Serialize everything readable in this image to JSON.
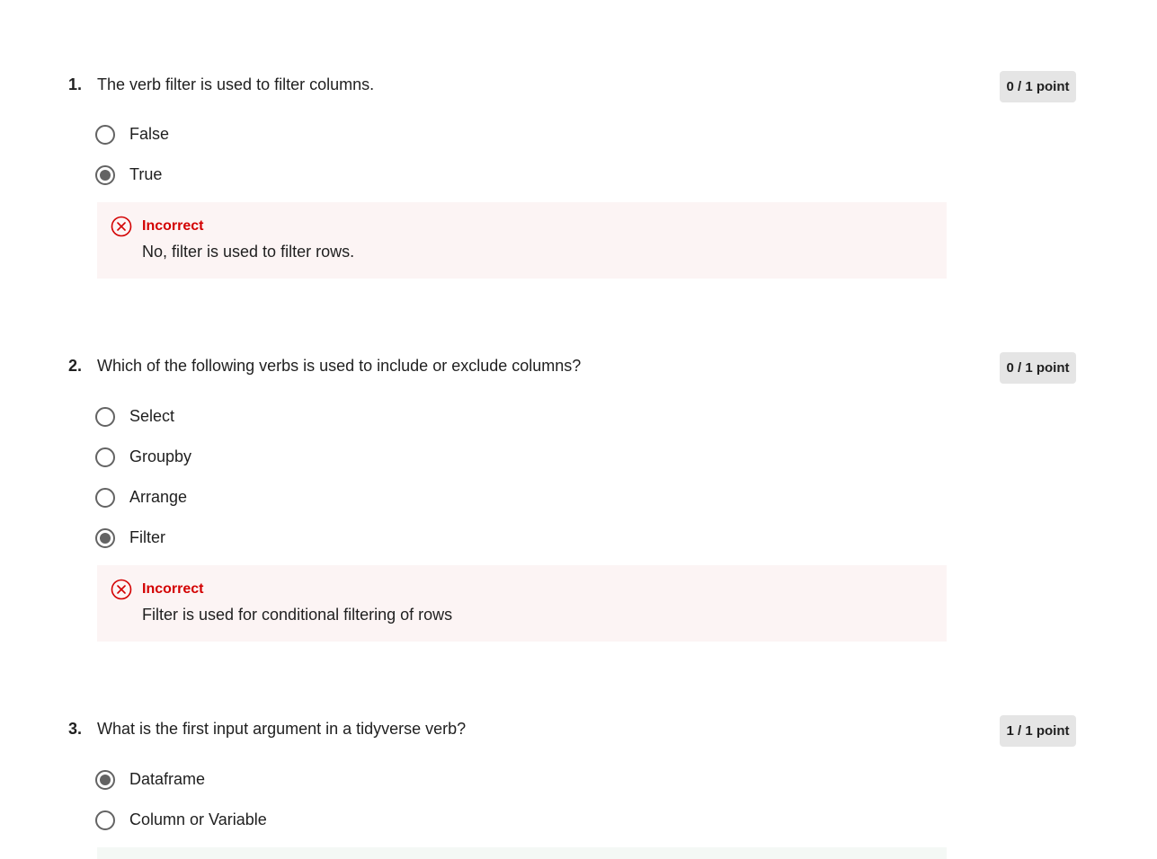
{
  "questions": [
    {
      "number": "1.",
      "text": "The verb filter is used to filter columns.",
      "points": "0 / 1 point",
      "options": [
        {
          "label": "False",
          "selected": false
        },
        {
          "label": "True",
          "selected": true
        }
      ],
      "feedback": {
        "status": "Incorrect",
        "text": "No, filter is used to filter rows.",
        "icon": "x-circle-icon"
      }
    },
    {
      "number": "2.",
      "text": "Which of the following verbs is used to include or exclude columns?",
      "points": "0 / 1 point",
      "options": [
        {
          "label": "Select",
          "selected": false
        },
        {
          "label": "Groupby",
          "selected": false
        },
        {
          "label": "Arrange",
          "selected": false
        },
        {
          "label": "Filter",
          "selected": true
        }
      ],
      "feedback": {
        "status": "Incorrect",
        "text": "Filter is used for conditional filtering of rows",
        "icon": "x-circle-icon"
      }
    },
    {
      "number": "3.",
      "text": "What is the first input argument in a tidyverse verb?",
      "points": "1 / 1 point",
      "options": [
        {
          "label": "Dataframe",
          "selected": true
        },
        {
          "label": "Column or Variable",
          "selected": false
        }
      ]
    }
  ],
  "colors": {
    "incorrect": "#d30001",
    "incorrect_bg": "#fcf4f4",
    "correct_bg": "#f4f8f5",
    "points_badge_bg": "#e5e5e5",
    "radio": "#636363"
  }
}
